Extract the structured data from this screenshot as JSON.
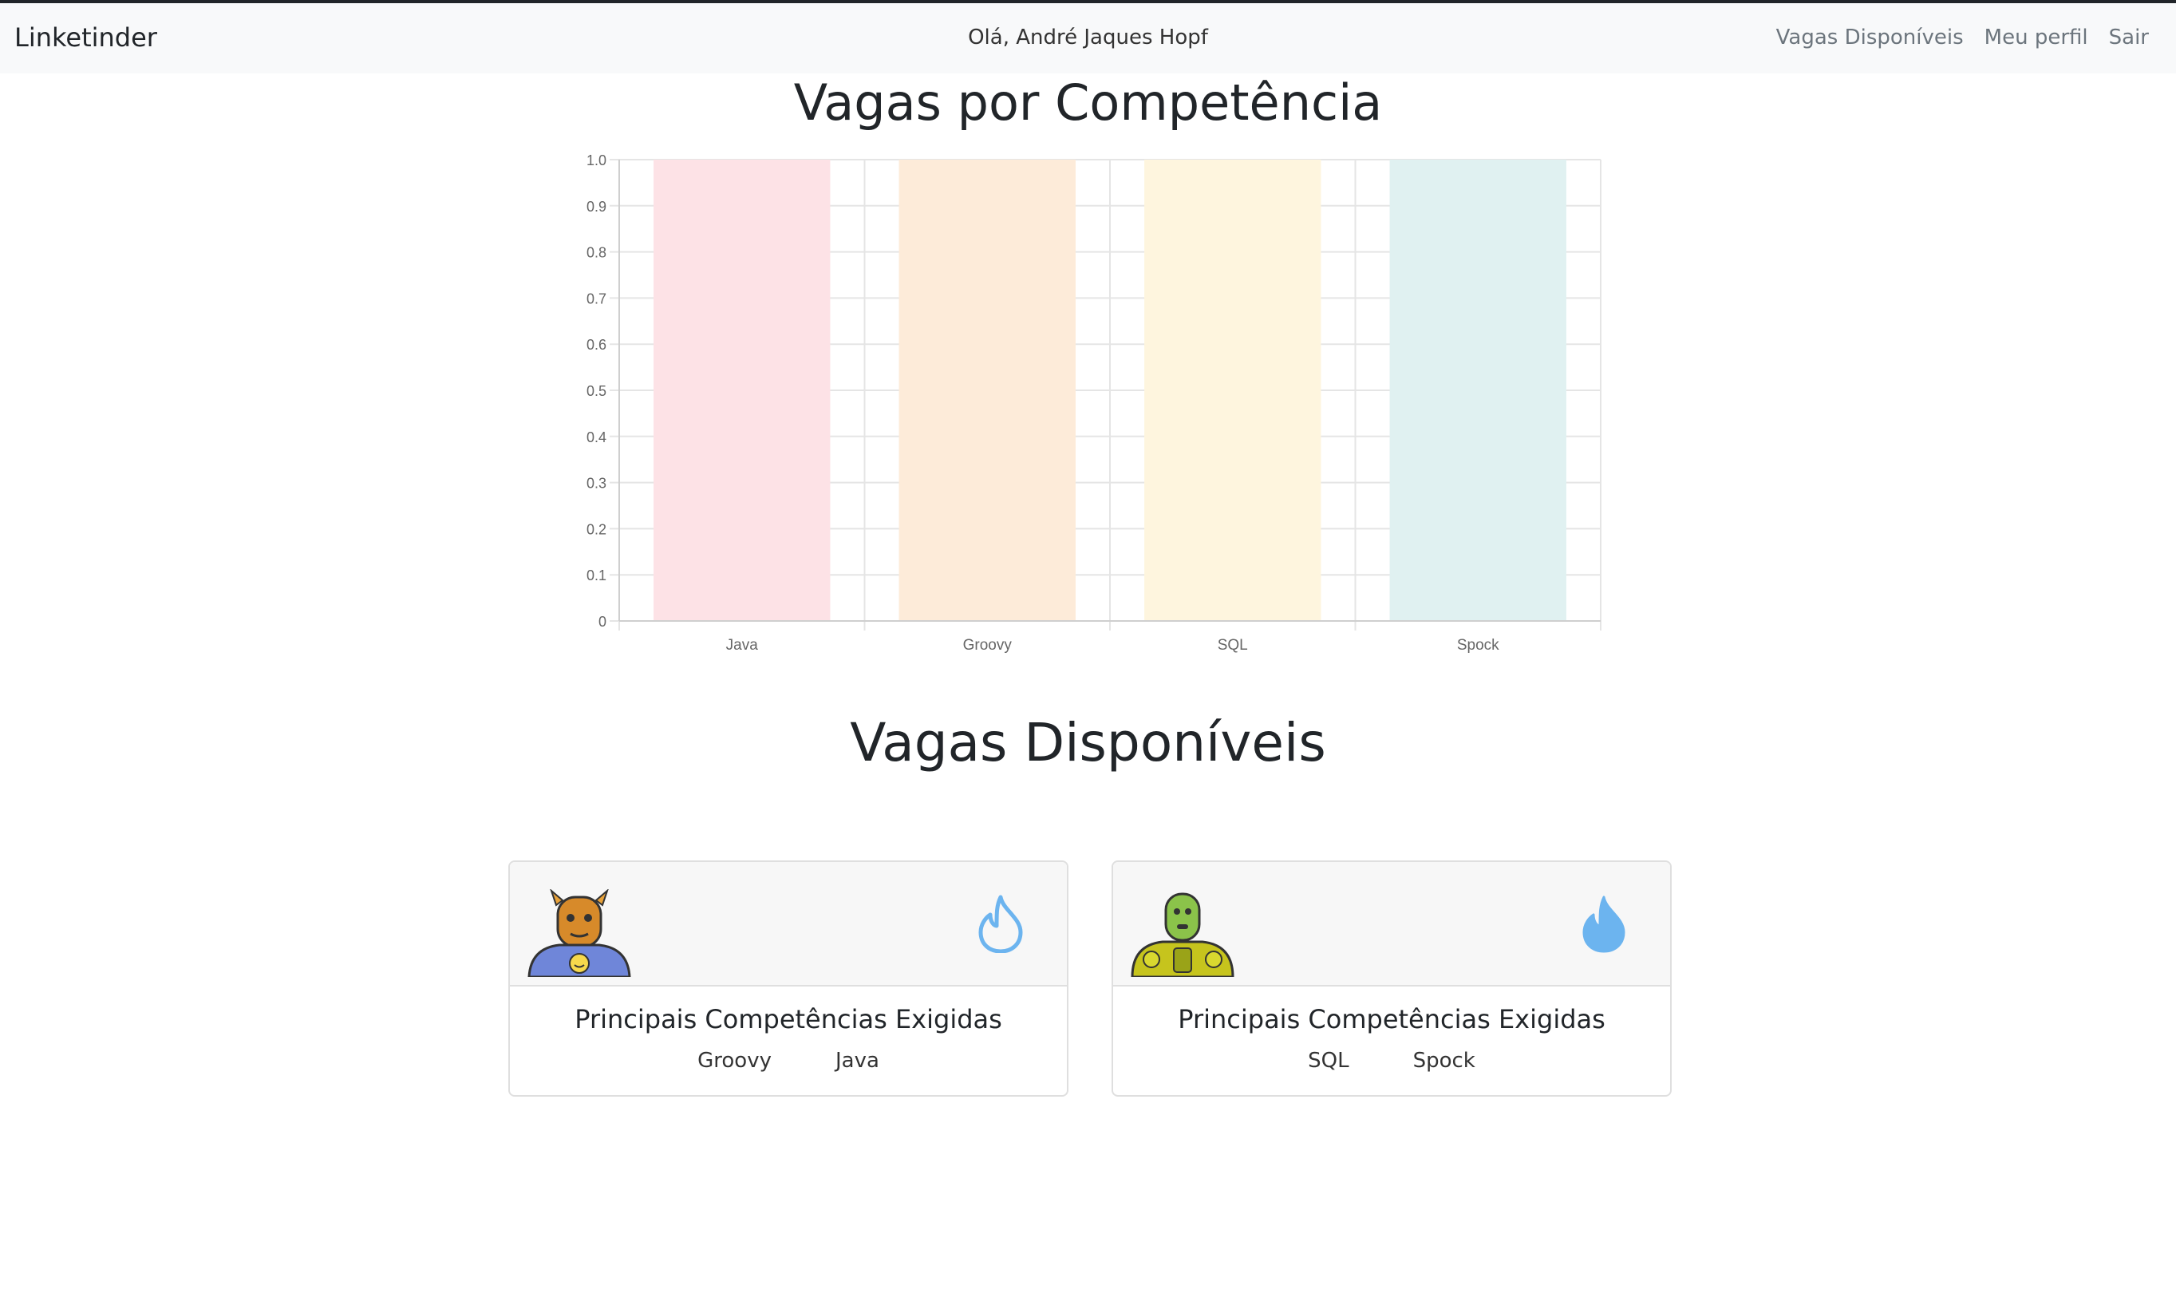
{
  "navbar": {
    "brand": "Linketinder",
    "greeting": "Olá, André Jaques Hopf",
    "links": [
      "Vagas Disponíveis",
      "Meu perfil",
      "Sair"
    ]
  },
  "chart_section": {
    "title": "Vagas por Competência"
  },
  "chart_data": {
    "type": "bar",
    "categories": [
      "Java",
      "Groovy",
      "SQL",
      "Spock"
    ],
    "values": [
      1,
      1,
      1,
      1
    ],
    "colors": [
      "#fde2e6",
      "#fdebd9",
      "#fef5de",
      "#e0f1f1"
    ],
    "ylim": [
      0,
      1
    ],
    "yticks": [
      "0",
      "0.1",
      "0.2",
      "0.3",
      "0.4",
      "0.5",
      "0.6",
      "0.7",
      "0.8",
      "0.9",
      "1.0"
    ],
    "grid": true,
    "title": "",
    "xlabel": "",
    "ylabel": ""
  },
  "jobs_section": {
    "title": "Vagas Disponíveis",
    "cards": [
      {
        "avatar_icon": "robot-avatar-icon",
        "flame_icon": "flame-outline-icon",
        "heading": "Principais Competências Exigidas",
        "skills": [
          "Groovy",
          "Java"
        ]
      },
      {
        "avatar_icon": "robot-avatar-icon",
        "flame_icon": "flame-filled-icon",
        "heading": "Principais Competências Exigidas",
        "skills": [
          "SQL",
          "Spock"
        ]
      }
    ]
  },
  "colors": {
    "navbar_bg": "#f8f9fa",
    "flame": "#6cb4ef",
    "card_header_bg": "#f7f7f7"
  }
}
